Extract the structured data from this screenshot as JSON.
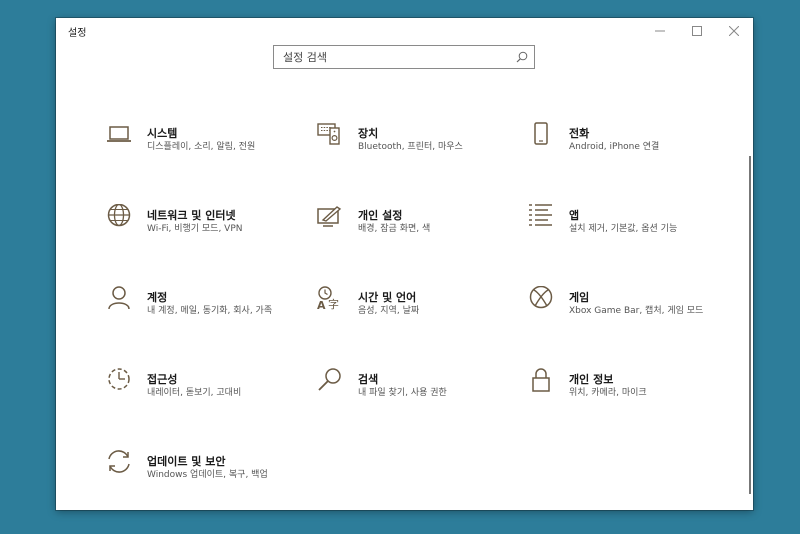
{
  "window": {
    "title": "설정"
  },
  "search": {
    "placeholder": "설정 검색"
  },
  "items": [
    {
      "name": "시스템",
      "desc": "디스플레이, 소리, 알림, 전원",
      "icon": "laptop-icon"
    },
    {
      "name": "장치",
      "desc": "Bluetooth, 프린터, 마우스",
      "icon": "devices-icon"
    },
    {
      "name": "전화",
      "desc": "Android, iPhone 연결",
      "icon": "phone-icon"
    },
    {
      "name": "네트워크 및 인터넷",
      "desc": "Wi-Fi, 비행기 모드, VPN",
      "icon": "globe-icon"
    },
    {
      "name": "개인 설정",
      "desc": "배경, 잠금 화면, 색",
      "icon": "personalization-icon"
    },
    {
      "name": "앱",
      "desc": "설치 제거, 기본값, 옵션 기능",
      "icon": "apps-list-icon"
    },
    {
      "name": "계정",
      "desc": "내 계정, 메일, 동기화, 회사, 가족",
      "icon": "person-icon"
    },
    {
      "name": "시간 및 언어",
      "desc": "음성, 지역, 날짜",
      "icon": "time-language-icon"
    },
    {
      "name": "게임",
      "desc": "Xbox Game Bar, 캡처, 게임 모드",
      "icon": "xbox-icon"
    },
    {
      "name": "접근성",
      "desc": "내레이터, 돋보기, 고대비",
      "icon": "accessibility-icon"
    },
    {
      "name": "검색",
      "desc": "내 파일 찾기, 사용 권한",
      "icon": "search-icon"
    },
    {
      "name": "개인 정보",
      "desc": "위치, 카메라, 마이크",
      "icon": "lock-icon"
    },
    {
      "name": "업데이트 및 보안",
      "desc": "Windows 업데이트, 복구, 백업",
      "icon": "update-icon"
    }
  ],
  "colors": {
    "accent_icon": "#6b5b45",
    "desktop": "#2d7d9a"
  }
}
